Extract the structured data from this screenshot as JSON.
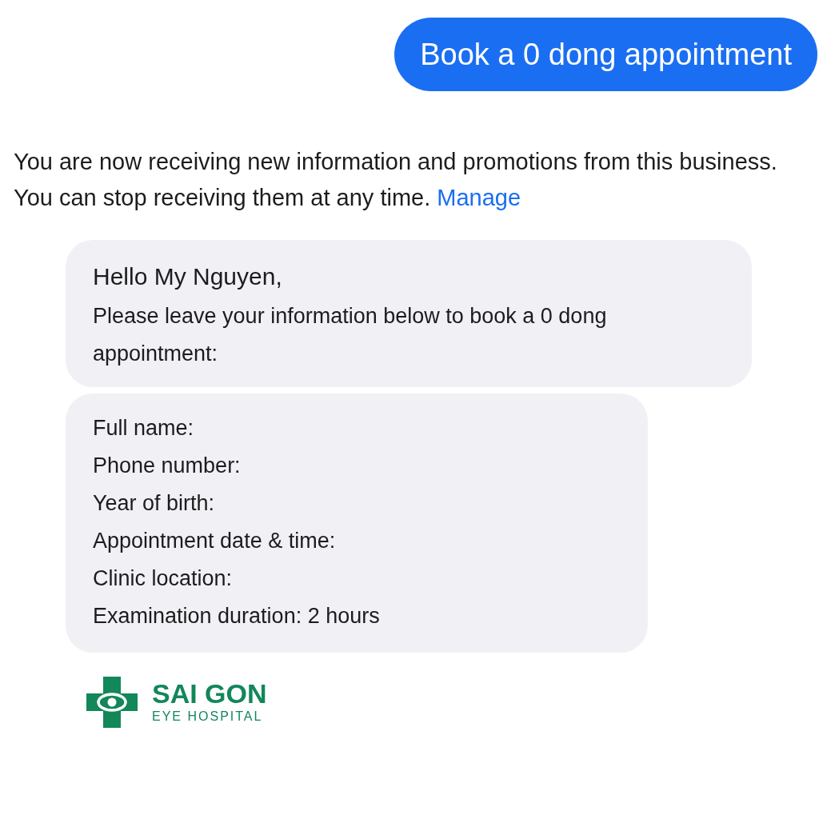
{
  "sent_message": {
    "text": "Book a 0 dong appointment"
  },
  "notice": {
    "text": "You are now receiving new information and promotions from this business. You can stop receiving them at any time.",
    "link": "Manage"
  },
  "messages": [
    {
      "lines": [
        "Hello My Nguyen,",
        "Please leave your information below to book a 0 dong appointment:"
      ]
    },
    {
      "lines": [
        "Full name:",
        "Phone number:",
        "Year of birth:",
        "Appointment date & time:",
        "Clinic location:",
        "Examination duration: 2 hours"
      ]
    }
  ],
  "logo": {
    "name": "SAI GON",
    "subtitle": "EYE HOSPITAL"
  }
}
